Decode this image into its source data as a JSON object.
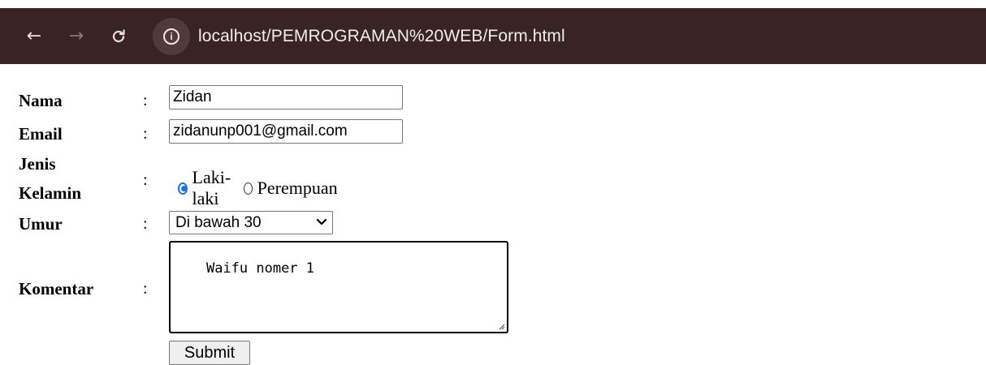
{
  "browser": {
    "url": "localhost/PEMROGRAMAN%20WEB/Form.html",
    "back_glyph": "←",
    "forward_glyph": "→",
    "reload_glyph": "C",
    "info_glyph": "i",
    "toolbar_color": "#3a2324"
  },
  "form": {
    "separator": ":",
    "nama": {
      "label": "Nama",
      "value": "Zidan"
    },
    "email": {
      "label": "Email",
      "value": "zidanunp001@gmail.com"
    },
    "gender": {
      "label_line1": "Jenis",
      "label_line2": "Kelamin",
      "options": [
        {
          "label": "Laki-laki",
          "checked": true
        },
        {
          "label": "Perempuan",
          "checked": false
        }
      ]
    },
    "umur": {
      "label": "Umur",
      "selected": "Di bawah 30"
    },
    "komentar": {
      "label": "Komentar",
      "value": "Waifu nomer 1"
    },
    "submit_label": "Submit",
    "accent_color": "#1a73e8"
  }
}
